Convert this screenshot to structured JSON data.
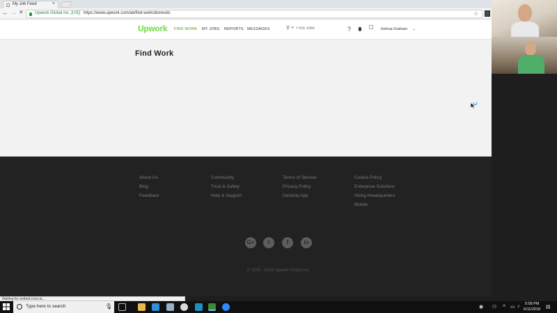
{
  "browser": {
    "tab_title": "My Job Feed",
    "secure_label": "Upwork Global Inc. [US]",
    "url": "https://www.upwork.com/ab/find-work/domestic"
  },
  "header": {
    "logo": "Upwork",
    "nav": [
      "FIND WORK",
      "MY JOBS",
      "REPORTS",
      "MESSAGES"
    ],
    "search_placeholder": "Find Jobs",
    "user_name": "Joshua Graham"
  },
  "main": {
    "title": "Find Work"
  },
  "footer": {
    "col1": [
      "About Us",
      "Blog",
      "Feedback"
    ],
    "col2": [
      "Community",
      "Trust & Safety",
      "Help & Support"
    ],
    "col3": [
      "Terms of Service",
      "Privacy Policy",
      "Desktop App"
    ],
    "col4": [
      "Cookie Policy",
      "Enterprise Solutions",
      "Hiring Headquarters",
      "Mobile"
    ],
    "social": [
      "google-plus",
      "twitter",
      "facebook",
      "linkedin"
    ],
    "copyright": "© 2015 - 2018 Upwork Global Inc."
  },
  "status_bar": "Waiting for embed.rcrsv.io...",
  "taskbar": {
    "search_placeholder": "Type here to search",
    "time": "5:58 PM",
    "date": "6/11/2018"
  },
  "colors": {
    "brand_green": "#6fda44",
    "nav_active": "#37a000",
    "footer_bg": "#222222"
  }
}
